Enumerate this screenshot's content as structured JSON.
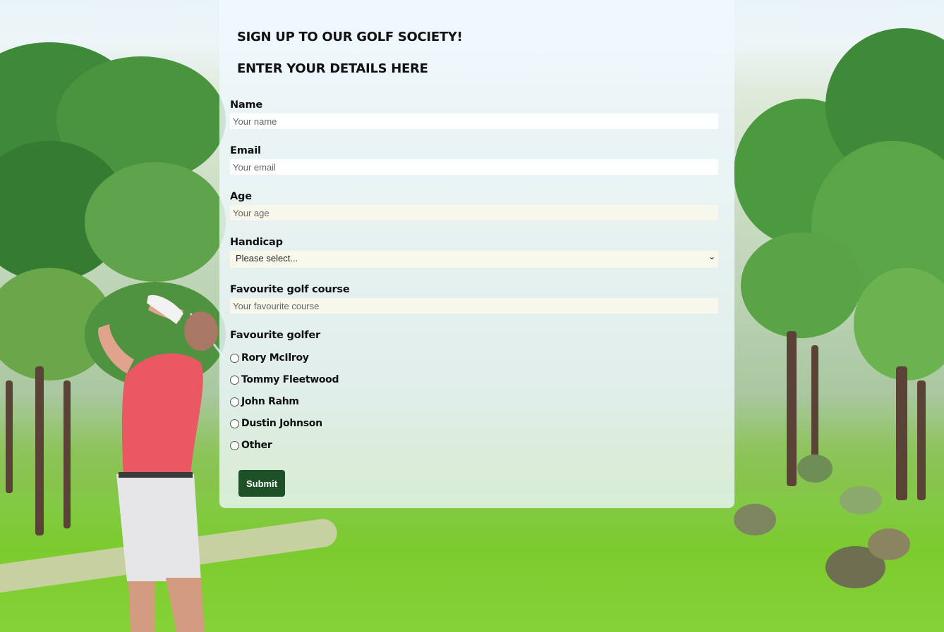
{
  "form": {
    "heading": "SIGN UP TO OUR GOLF SOCIETY!",
    "subheading": "ENTER YOUR DETAILS HERE",
    "name": {
      "label": "Name",
      "placeholder": "Your name"
    },
    "email": {
      "label": "Email",
      "placeholder": "Your email"
    },
    "age": {
      "label": "Age",
      "placeholder": "Your age"
    },
    "handicap": {
      "label": "Handicap",
      "selected": "Please select..."
    },
    "course": {
      "label": "Favourite golf course",
      "placeholder": "Your favourite course"
    },
    "golfer": {
      "label": "Favourite golfer",
      "options": [
        "Rory McIlroy",
        "Tommy Fleetwood",
        "John Rahm",
        "Dustin Johnson",
        "Other"
      ]
    },
    "submit_label": "Submit"
  },
  "colors": {
    "panel": "#f0f8ff",
    "submit": "#1e5128"
  },
  "icons": {
    "select_arrow": "chevron-down-icon",
    "radio": "radio-circle-icon"
  }
}
